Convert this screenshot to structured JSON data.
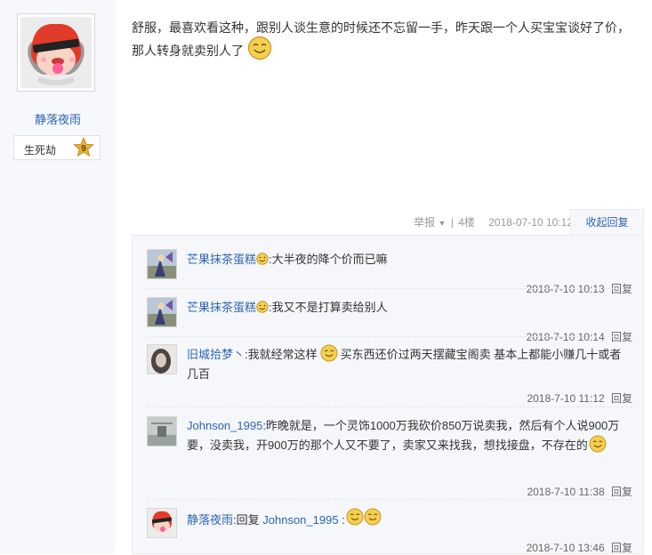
{
  "author": {
    "name": "静落夜雨",
    "rank_title": "生死劫",
    "level": "9"
  },
  "post": {
    "text_part1": "舒服，最喜欢看这种，跟别人谈生意的时候还不忘留一手，昨天跟一个人买宝宝谈好了价，那人转身就卖别人了",
    "report_label": "举报",
    "floor": "4楼",
    "datetime": "2018-07-10 10:12",
    "collapse_label": "收起回复",
    "separator": "|"
  },
  "replies": [
    {
      "user": "芒果抹茶蛋糕",
      "text": ":大半夜的降个价而已嘛",
      "time": "2018-7-10 10:13",
      "reply_label": "回复"
    },
    {
      "user": "芒果抹茶蛋糕",
      "text": ":我又不是打算卖给别人",
      "time": "2018-7-10 10:14",
      "reply_label": "回复"
    },
    {
      "user": "旧城拾梦丶",
      "text_before": ":我就经常这样",
      "text_after": "买东西还价过两天摆藏宝阁卖 基本上都能小赚几十或者几百",
      "time": "2018-7-10 11:12",
      "reply_label": "回复"
    },
    {
      "user": "Johnson_1995",
      "text": ":昨晚就是，一个灵饰1000万我砍价850万说卖我，然后有个人说900万要，没卖我，开900万的那个人又不要了，卖家又来找我，想找接盘，不存在的",
      "time": "2018-7-10 11:38",
      "reply_label": "回复"
    },
    {
      "user": "静落夜雨",
      "text_before": ":回复 ",
      "mention": "Johnson_1995",
      "text_after": " :",
      "time": "2018-7-10 13:46",
      "reply_label": "回复"
    }
  ],
  "colors": {
    "link": "#2d64b3",
    "panel_bg": "#f5f7fa",
    "left_bg": "#f6f8fb",
    "emoticon": "#f4c542"
  }
}
